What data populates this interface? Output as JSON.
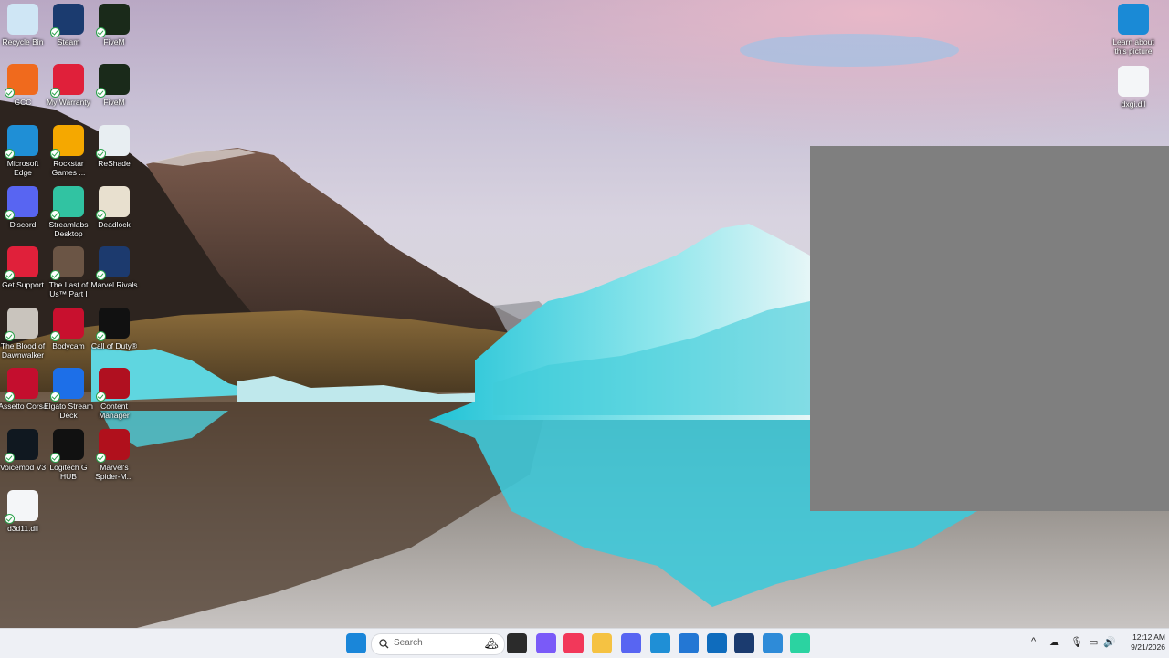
{
  "desktop": {
    "icons": [
      {
        "label": "Recycle Bin",
        "icon": "recycle-bin-icon",
        "color": "#cfe6f5"
      },
      {
        "label": "Steam",
        "icon": "steam-icon",
        "color": "#1b3b6f"
      },
      {
        "label": "FiveM",
        "icon": "fivem-icon",
        "color": "#1a2a1a"
      },
      {
        "label": "GCC",
        "icon": "gcc-icon",
        "color": "#f06a1d"
      },
      {
        "label": "My Warranty",
        "icon": "warranty-icon",
        "color": "#e0203a"
      },
      {
        "label": "FiveM",
        "icon": "fivem-icon",
        "color": "#1a2a1a"
      },
      {
        "label": "Microsoft Edge",
        "icon": "edge-icon",
        "color": "#1f8fd6"
      },
      {
        "label": "Rockstar Games ...",
        "icon": "rockstar-icon",
        "color": "#f5a800"
      },
      {
        "label": "ReShade",
        "icon": "reshade-icon",
        "color": "#e8eef2"
      },
      {
        "label": "Discord",
        "icon": "discord-icon",
        "color": "#5865f2"
      },
      {
        "label": "Streamlabs Desktop",
        "icon": "streamlabs-icon",
        "color": "#31c3a2"
      },
      {
        "label": "Deadlock",
        "icon": "deadlock-icon",
        "color": "#e8e0cf"
      },
      {
        "label": "Get Support",
        "icon": "support-icon",
        "color": "#e0203a"
      },
      {
        "label": "The Last of Us™ Part I",
        "icon": "tlou-icon",
        "color": "#6b5545"
      },
      {
        "label": "Marvel Rivals",
        "icon": "marvel-rivals-icon",
        "color": "#1c3a6e"
      },
      {
        "label": "The Blood of Dawnwalker",
        "icon": "dawnwalker-icon",
        "color": "#c9c4bd"
      },
      {
        "label": "Bodycam",
        "icon": "bodycam-icon",
        "color": "#c8102e"
      },
      {
        "label": "Call of Duty®",
        "icon": "cod-icon",
        "color": "#111111"
      },
      {
        "label": "Assetto Corsa",
        "icon": "assetto-corsa-icon",
        "color": "#c40e2e"
      },
      {
        "label": "Elgato Stream Deck",
        "icon": "streamdeck-icon",
        "color": "#1d6fe8"
      },
      {
        "label": "Content Manager",
        "icon": "content-manager-icon",
        "color": "#b01020"
      },
      {
        "label": "Voicemod V3",
        "icon": "voicemod-icon",
        "color": "#101820"
      },
      {
        "label": "Logitech G HUB",
        "icon": "ghub-icon",
        "color": "#111111"
      },
      {
        "label": "Marvel's Spider-M...",
        "icon": "spiderman-icon",
        "color": "#b0101c"
      },
      {
        "label": "d3d11.dll",
        "icon": "dll-file-icon",
        "color": "#f4f6f8"
      }
    ],
    "right_icons": [
      {
        "label": "Learn about this picture",
        "icon": "info-icon",
        "color": "#1a8ad6"
      },
      {
        "label": "dxgi.dll",
        "icon": "dll-file-icon",
        "color": "#f4f6f8"
      }
    ]
  },
  "taskbar": {
    "search_placeholder": "Search",
    "apps": [
      {
        "icon": "start-icon",
        "color": "#1a86d9"
      },
      {
        "icon": "task-view-icon",
        "color": "#2b2b2b"
      },
      {
        "icon": "copilot-icon",
        "color": "#7a5af8"
      },
      {
        "icon": "music-icon",
        "color": "#f2385a"
      },
      {
        "icon": "file-explorer-icon",
        "color": "#f5c242"
      },
      {
        "icon": "discord-icon",
        "color": "#5865f2"
      },
      {
        "icon": "edge-icon",
        "color": "#1f8fd6"
      },
      {
        "icon": "store-icon",
        "color": "#2377d4"
      },
      {
        "icon": "outlook-icon",
        "color": "#0f6cbd"
      },
      {
        "icon": "steam-icon",
        "color": "#1b3b6f"
      },
      {
        "icon": "photos-icon",
        "color": "#2e8bd8"
      },
      {
        "icon": "terminal-icon",
        "color": "#2bd3a1"
      }
    ],
    "clock_time": "12:12 AM",
    "clock_date": "9/21/2026"
  }
}
